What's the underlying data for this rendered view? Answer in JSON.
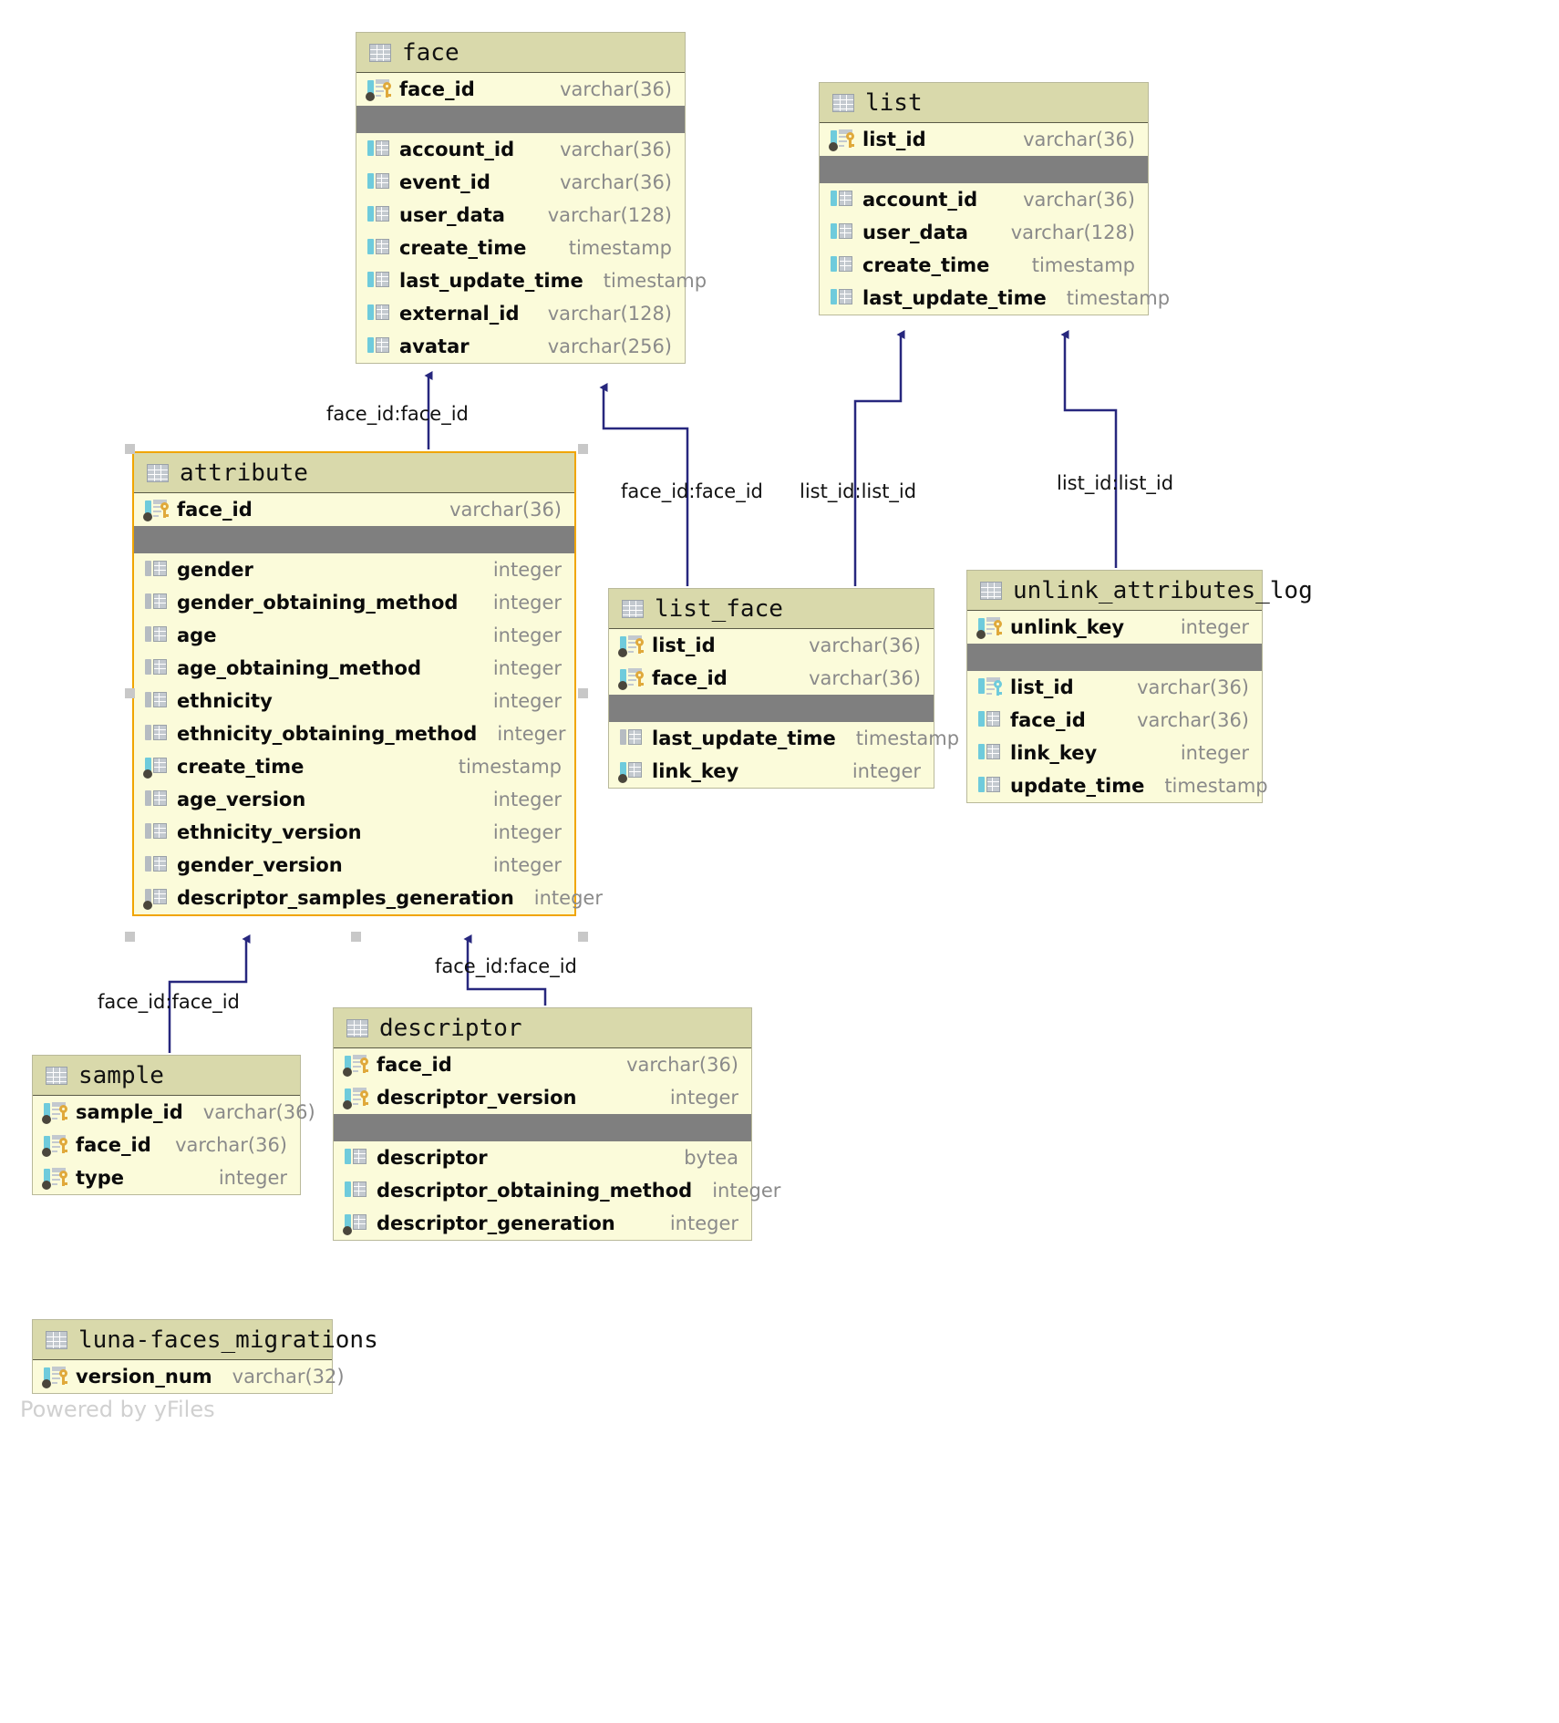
{
  "diagram": {
    "watermark": "Powered by yFiles",
    "accent_selected": "#f0a500",
    "node_fill": "#fbfbda",
    "node_title_fill": "#d9d9ab",
    "divider_fill": "#7f7f7f",
    "edge_color": "#27277e",
    "notnull_color": "#6fcbdc",
    "nullable_color": "#b6bcc2",
    "pk_key_color": "#e0a93b",
    "fk_key_color": "#6fcbdc"
  },
  "tables": [
    {
      "id": "face",
      "name": "face",
      "selected": false,
      "keys": [
        {
          "name": "face_id",
          "type": "varchar(36)",
          "icon": "pk-key-icon",
          "nullable": false,
          "indexed": true
        }
      ],
      "columns": [
        {
          "name": "account_id",
          "type": "varchar(36)",
          "icon": "column-icon",
          "nullable": false,
          "indexed": false
        },
        {
          "name": "event_id",
          "type": "varchar(36)",
          "icon": "column-icon",
          "nullable": false,
          "indexed": false
        },
        {
          "name": "user_data",
          "type": "varchar(128)",
          "icon": "column-icon",
          "nullable": false,
          "indexed": false
        },
        {
          "name": "create_time",
          "type": "timestamp",
          "icon": "column-icon",
          "nullable": false,
          "indexed": false
        },
        {
          "name": "last_update_time",
          "type": "timestamp",
          "icon": "column-icon",
          "nullable": false,
          "indexed": false
        },
        {
          "name": "external_id",
          "type": "varchar(128)",
          "icon": "column-icon",
          "nullable": false,
          "indexed": false
        },
        {
          "name": "avatar",
          "type": "varchar(256)",
          "icon": "column-icon",
          "nullable": false,
          "indexed": false
        }
      ]
    },
    {
      "id": "list",
      "name": "list",
      "selected": false,
      "keys": [
        {
          "name": "list_id",
          "type": "varchar(36)",
          "icon": "pk-key-icon",
          "nullable": false,
          "indexed": true
        }
      ],
      "columns": [
        {
          "name": "account_id",
          "type": "varchar(36)",
          "icon": "column-icon",
          "nullable": false,
          "indexed": false
        },
        {
          "name": "user_data",
          "type": "varchar(128)",
          "icon": "column-icon",
          "nullable": false,
          "indexed": false
        },
        {
          "name": "create_time",
          "type": "timestamp",
          "icon": "column-icon",
          "nullable": false,
          "indexed": false
        },
        {
          "name": "last_update_time",
          "type": "timestamp",
          "icon": "column-icon",
          "nullable": false,
          "indexed": false
        }
      ]
    },
    {
      "id": "attribute",
      "name": "attribute",
      "selected": true,
      "keys": [
        {
          "name": "face_id",
          "type": "varchar(36)",
          "icon": "pk-key-icon",
          "nullable": false,
          "indexed": true
        }
      ],
      "columns": [
        {
          "name": "gender",
          "type": "integer",
          "icon": "column-icon",
          "nullable": true,
          "indexed": false
        },
        {
          "name": "gender_obtaining_method",
          "type": "integer",
          "icon": "column-icon",
          "nullable": true,
          "indexed": false
        },
        {
          "name": "age",
          "type": "integer",
          "icon": "column-icon",
          "nullable": true,
          "indexed": false
        },
        {
          "name": "age_obtaining_method",
          "type": "integer",
          "icon": "column-icon",
          "nullable": true,
          "indexed": false
        },
        {
          "name": "ethnicity",
          "type": "integer",
          "icon": "column-icon",
          "nullable": true,
          "indexed": false
        },
        {
          "name": "ethnicity_obtaining_method",
          "type": "integer",
          "icon": "column-icon",
          "nullable": true,
          "indexed": false
        },
        {
          "name": "create_time",
          "type": "timestamp",
          "icon": "column-icon",
          "nullable": false,
          "indexed": true
        },
        {
          "name": "age_version",
          "type": "integer",
          "icon": "column-icon",
          "nullable": true,
          "indexed": false
        },
        {
          "name": "ethnicity_version",
          "type": "integer",
          "icon": "column-icon",
          "nullable": true,
          "indexed": false
        },
        {
          "name": "gender_version",
          "type": "integer",
          "icon": "column-icon",
          "nullable": true,
          "indexed": false
        },
        {
          "name": "descriptor_samples_generation",
          "type": "integer",
          "icon": "column-icon",
          "nullable": true,
          "indexed": true
        }
      ]
    },
    {
      "id": "list_face",
      "name": "list_face",
      "selected": false,
      "keys": [
        {
          "name": "list_id",
          "type": "varchar(36)",
          "icon": "pk-key-icon",
          "nullable": false,
          "indexed": true
        },
        {
          "name": "face_id",
          "type": "varchar(36)",
          "icon": "pk-key-icon",
          "nullable": false,
          "indexed": true
        }
      ],
      "columns": [
        {
          "name": "last_update_time",
          "type": "timestamp",
          "icon": "column-icon",
          "nullable": true,
          "indexed": false
        },
        {
          "name": "link_key",
          "type": "integer",
          "icon": "column-icon",
          "nullable": false,
          "indexed": true
        }
      ]
    },
    {
      "id": "unlink_attributes_log",
      "name": "unlink_attributes_log",
      "selected": false,
      "keys": [
        {
          "name": "unlink_key",
          "type": "integer",
          "icon": "pk-key-icon",
          "nullable": false,
          "indexed": true
        }
      ],
      "columns": [
        {
          "name": "list_id",
          "type": "varchar(36)",
          "icon": "fk-key-icon",
          "nullable": false,
          "indexed": false
        },
        {
          "name": "face_id",
          "type": "varchar(36)",
          "icon": "column-icon",
          "nullable": false,
          "indexed": false
        },
        {
          "name": "link_key",
          "type": "integer",
          "icon": "column-icon",
          "nullable": false,
          "indexed": false
        },
        {
          "name": "update_time",
          "type": "timestamp",
          "icon": "column-icon",
          "nullable": false,
          "indexed": false
        }
      ]
    },
    {
      "id": "sample",
      "name": "sample",
      "selected": false,
      "keys": [
        {
          "name": "sample_id",
          "type": "varchar(36)",
          "icon": "pk-key-icon",
          "nullable": false,
          "indexed": true
        },
        {
          "name": "face_id",
          "type": "varchar(36)",
          "icon": "pk-key-icon",
          "nullable": false,
          "indexed": true
        },
        {
          "name": "type",
          "type": "integer",
          "icon": "pk-key-icon",
          "nullable": false,
          "indexed": true
        }
      ],
      "columns": []
    },
    {
      "id": "descriptor",
      "name": "descriptor",
      "selected": false,
      "keys": [
        {
          "name": "face_id",
          "type": "varchar(36)",
          "icon": "pk-key-icon",
          "nullable": false,
          "indexed": true
        },
        {
          "name": "descriptor_version",
          "type": "integer",
          "icon": "pk-key-icon",
          "nullable": false,
          "indexed": true
        }
      ],
      "columns": [
        {
          "name": "descriptor",
          "type": "bytea",
          "icon": "column-icon",
          "nullable": false,
          "indexed": false
        },
        {
          "name": "descriptor_obtaining_method",
          "type": "integer",
          "icon": "column-icon",
          "nullable": false,
          "indexed": false
        },
        {
          "name": "descriptor_generation",
          "type": "integer",
          "icon": "column-icon",
          "nullable": false,
          "indexed": true
        }
      ]
    },
    {
      "id": "luna_faces_migrations",
      "name": "luna-faces_migrations",
      "selected": false,
      "keys": [
        {
          "name": "version_num",
          "type": "varchar(32)",
          "icon": "pk-key-icon",
          "nullable": false,
          "indexed": true
        }
      ],
      "columns": []
    }
  ],
  "relationships": [
    {
      "id": "attribute-face",
      "from": "attribute",
      "to": "face",
      "label": "face_id:face_id"
    },
    {
      "id": "list_face-face",
      "from": "list_face",
      "to": "face",
      "label": "face_id:face_id"
    },
    {
      "id": "list_face-list",
      "from": "list_face",
      "to": "list",
      "label": "list_id:list_id"
    },
    {
      "id": "unlink-list",
      "from": "unlink_attributes_log",
      "to": "list",
      "label": "list_id:list_id"
    },
    {
      "id": "sample-attribute",
      "from": "sample",
      "to": "attribute",
      "label": "face_id:face_id"
    },
    {
      "id": "descriptor-attribute",
      "from": "descriptor",
      "to": "attribute",
      "label": "face_id:face_id"
    }
  ]
}
